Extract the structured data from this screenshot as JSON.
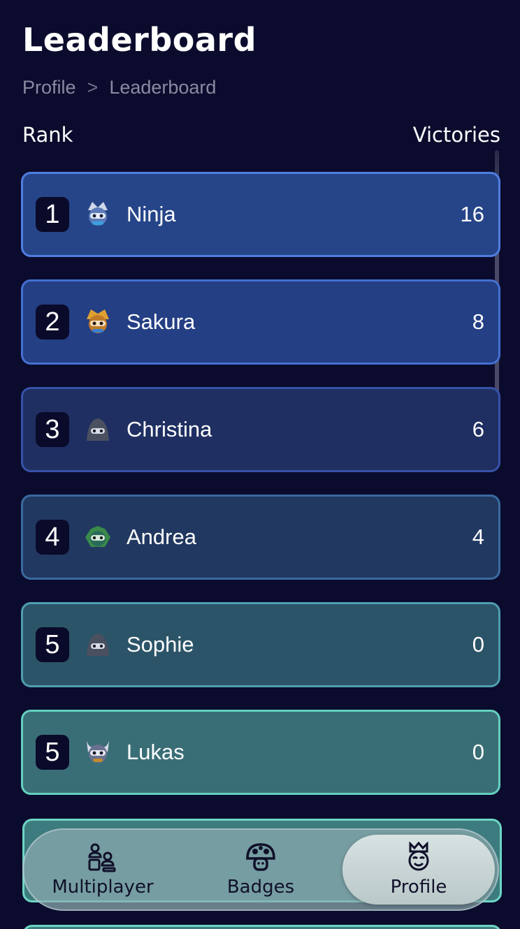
{
  "header": {
    "title": "Leaderboard",
    "breadcrumb": [
      "Profile",
      ">",
      "Leaderboard"
    ]
  },
  "columns": {
    "rank": "Rank",
    "victories": "Victories"
  },
  "rows": [
    {
      "rank": "1",
      "name": "Ninja",
      "victories": "16",
      "avatar": "ninja-crown-avatar",
      "bg": "#264589",
      "border": "#4f7ee0"
    },
    {
      "rank": "2",
      "name": "Sakura",
      "victories": "8",
      "avatar": "golden-samurai-avatar",
      "bg": "#243f84",
      "border": "#4470d0"
    },
    {
      "rank": "3",
      "name": "Christina",
      "victories": "6",
      "avatar": "hooded-ninja-avatar",
      "bg": "#1f2f62",
      "border": "#3652a8"
    },
    {
      "rank": "4",
      "name": "Andrea",
      "victories": "4",
      "avatar": "green-warrior-avatar",
      "bg": "#213860",
      "border": "#3a6aa0"
    },
    {
      "rank": "5",
      "name": "Sophie",
      "victories": "0",
      "avatar": "hooded-ninja-avatar",
      "bg": "#2c5468",
      "border": "#4f9eb0"
    },
    {
      "rank": "5",
      "name": "Lukas",
      "victories": "0",
      "avatar": "horned-helmet-avatar",
      "bg": "#3a6e76",
      "border": "#64cfc0"
    }
  ],
  "nav": {
    "items": [
      {
        "label": "Multiplayer",
        "icon": "multiplayer-icon"
      },
      {
        "label": "Badges",
        "icon": "mushroom-badge-icon"
      },
      {
        "label": "Profile",
        "icon": "crowned-face-icon",
        "active": true
      }
    ]
  },
  "colors": {
    "background": "#0b0b2d",
    "rank_box": "#0a0a2a"
  }
}
